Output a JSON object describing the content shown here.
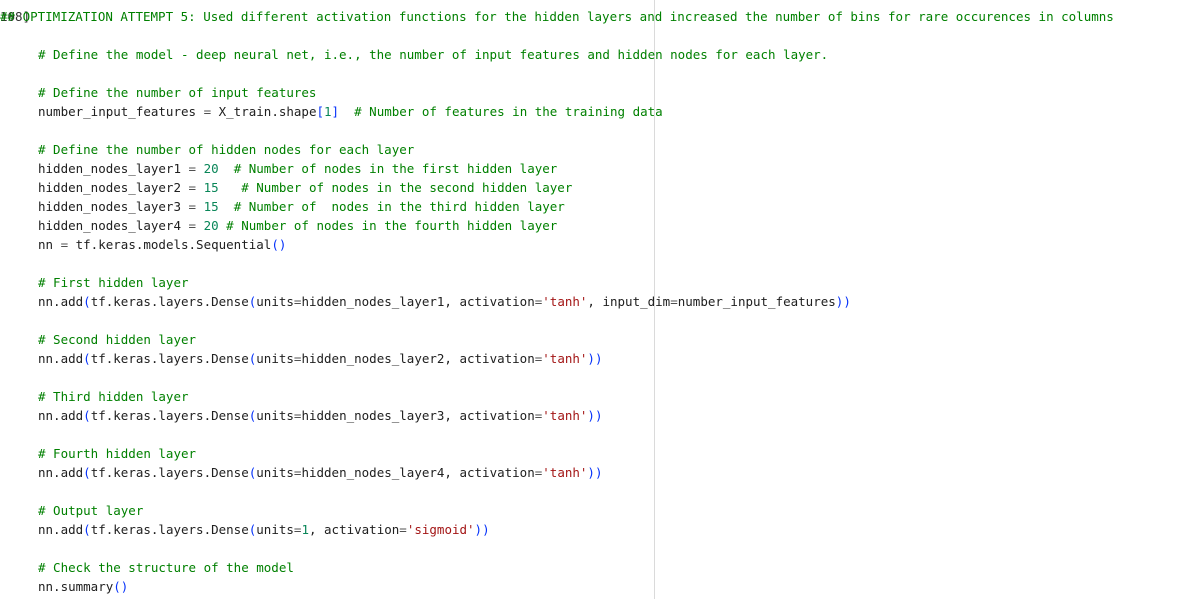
{
  "cell": {
    "execution_count": "108]",
    "lines": [
      [
        {
          "t": "c",
          "s": "## OPTIMIZATION ATTEMPT 5: Used different activation functions for the hidden layers and increased the number of bins for rare occurences in columns"
        }
      ],
      [],
      [
        {
          "t": "c",
          "s": "# Define the model - deep neural net, i.e., the number of input features and hidden nodes for each layer."
        }
      ],
      [],
      [
        {
          "t": "c",
          "s": "# Define the number of input features"
        }
      ],
      [
        {
          "t": "p",
          "s": "number_input_features "
        },
        {
          "t": "o",
          "s": "="
        },
        {
          "t": "p",
          "s": " X_train.shape"
        },
        {
          "t": "b",
          "s": "["
        },
        {
          "t": "n",
          "s": "1"
        },
        {
          "t": "b",
          "s": "]"
        },
        {
          "t": "p",
          "s": "  "
        },
        {
          "t": "c",
          "s": "# Number of features in the training data"
        }
      ],
      [],
      [
        {
          "t": "c",
          "s": "# Define the number of hidden nodes for each layer"
        }
      ],
      [
        {
          "t": "p",
          "s": "hidden_nodes_layer1 "
        },
        {
          "t": "o",
          "s": "="
        },
        {
          "t": "p",
          "s": " "
        },
        {
          "t": "n",
          "s": "20"
        },
        {
          "t": "p",
          "s": "  "
        },
        {
          "t": "c",
          "s": "# Number of nodes in the first hidden layer"
        }
      ],
      [
        {
          "t": "p",
          "s": "hidden_nodes_layer2 "
        },
        {
          "t": "o",
          "s": "="
        },
        {
          "t": "p",
          "s": " "
        },
        {
          "t": "n",
          "s": "15"
        },
        {
          "t": "p",
          "s": "   "
        },
        {
          "t": "c",
          "s": "# Number of nodes in the second hidden layer"
        }
      ],
      [
        {
          "t": "p",
          "s": "hidden_nodes_layer3 "
        },
        {
          "t": "o",
          "s": "="
        },
        {
          "t": "p",
          "s": " "
        },
        {
          "t": "n",
          "s": "15"
        },
        {
          "t": "p",
          "s": "  "
        },
        {
          "t": "c",
          "s": "# Number of  nodes in the third hidden layer"
        }
      ],
      [
        {
          "t": "p",
          "s": "hidden_nodes_layer4 "
        },
        {
          "t": "o",
          "s": "="
        },
        {
          "t": "p",
          "s": " "
        },
        {
          "t": "n",
          "s": "20"
        },
        {
          "t": "p",
          "s": " "
        },
        {
          "t": "c",
          "s": "# Number of nodes in the fourth hidden layer"
        }
      ],
      [
        {
          "t": "p",
          "s": "nn "
        },
        {
          "t": "o",
          "s": "="
        },
        {
          "t": "p",
          "s": " tf.keras.models.Sequential"
        },
        {
          "t": "b",
          "s": "()"
        }
      ],
      [],
      [
        {
          "t": "c",
          "s": "# First hidden layer"
        }
      ],
      [
        {
          "t": "p",
          "s": "nn.add"
        },
        {
          "t": "b",
          "s": "("
        },
        {
          "t": "p",
          "s": "tf.keras.layers.Dense"
        },
        {
          "t": "b",
          "s": "("
        },
        {
          "t": "p",
          "s": "units"
        },
        {
          "t": "o",
          "s": "="
        },
        {
          "t": "p",
          "s": "hidden_nodes_layer1, activation"
        },
        {
          "t": "o",
          "s": "="
        },
        {
          "t": "s",
          "s": "'tanh'"
        },
        {
          "t": "p",
          "s": ", input_dim"
        },
        {
          "t": "o",
          "s": "="
        },
        {
          "t": "p",
          "s": "number_input_features"
        },
        {
          "t": "b",
          "s": "))"
        }
      ],
      [],
      [
        {
          "t": "c",
          "s": "# Second hidden layer"
        }
      ],
      [
        {
          "t": "p",
          "s": "nn.add"
        },
        {
          "t": "b",
          "s": "("
        },
        {
          "t": "p",
          "s": "tf.keras.layers.Dense"
        },
        {
          "t": "b",
          "s": "("
        },
        {
          "t": "p",
          "s": "units"
        },
        {
          "t": "o",
          "s": "="
        },
        {
          "t": "p",
          "s": "hidden_nodes_layer2, activation"
        },
        {
          "t": "o",
          "s": "="
        },
        {
          "t": "s",
          "s": "'tanh'"
        },
        {
          "t": "b",
          "s": "))"
        }
      ],
      [],
      [
        {
          "t": "c",
          "s": "# Third hidden layer"
        }
      ],
      [
        {
          "t": "p",
          "s": "nn.add"
        },
        {
          "t": "b",
          "s": "("
        },
        {
          "t": "p",
          "s": "tf.keras.layers.Dense"
        },
        {
          "t": "b",
          "s": "("
        },
        {
          "t": "p",
          "s": "units"
        },
        {
          "t": "o",
          "s": "="
        },
        {
          "t": "p",
          "s": "hidden_nodes_layer3, activation"
        },
        {
          "t": "o",
          "s": "="
        },
        {
          "t": "s",
          "s": "'tanh'"
        },
        {
          "t": "b",
          "s": "))"
        }
      ],
      [],
      [
        {
          "t": "c",
          "s": "# Fourth hidden layer"
        }
      ],
      [
        {
          "t": "p",
          "s": "nn.add"
        },
        {
          "t": "b",
          "s": "("
        },
        {
          "t": "p",
          "s": "tf.keras.layers.Dense"
        },
        {
          "t": "b",
          "s": "("
        },
        {
          "t": "p",
          "s": "units"
        },
        {
          "t": "o",
          "s": "="
        },
        {
          "t": "p",
          "s": "hidden_nodes_layer4, activation"
        },
        {
          "t": "o",
          "s": "="
        },
        {
          "t": "s",
          "s": "'tanh'"
        },
        {
          "t": "b",
          "s": "))"
        }
      ],
      [],
      [
        {
          "t": "c",
          "s": "# Output layer"
        }
      ],
      [
        {
          "t": "p",
          "s": "nn.add"
        },
        {
          "t": "b",
          "s": "("
        },
        {
          "t": "p",
          "s": "tf.keras.layers.Dense"
        },
        {
          "t": "b",
          "s": "("
        },
        {
          "t": "p",
          "s": "units"
        },
        {
          "t": "o",
          "s": "="
        },
        {
          "t": "n",
          "s": "1"
        },
        {
          "t": "p",
          "s": ", activation"
        },
        {
          "t": "o",
          "s": "="
        },
        {
          "t": "s",
          "s": "'sigmoid'"
        },
        {
          "t": "b",
          "s": "))"
        }
      ],
      [],
      [
        {
          "t": "c",
          "s": "# Check the structure of the model"
        }
      ],
      [
        {
          "t": "p",
          "s": "nn.summary"
        },
        {
          "t": "b",
          "s": "()"
        }
      ]
    ]
  },
  "colors": {
    "comment": "#008000",
    "string": "#a31515",
    "number": "#098658",
    "bracket": "#0431fa",
    "text": "#202020"
  }
}
